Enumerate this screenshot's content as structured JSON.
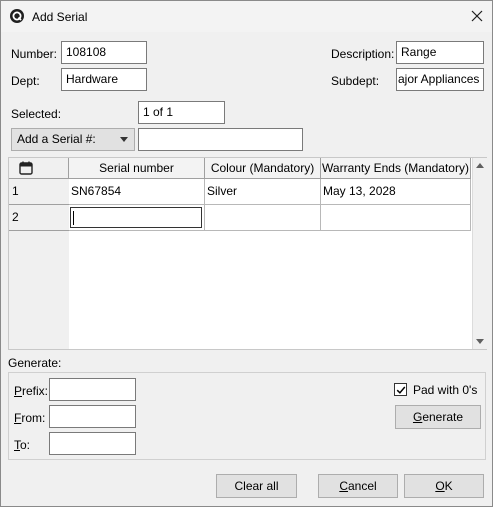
{
  "window": {
    "title": "Add Serial",
    "app_icon": "app-logo-icon",
    "close_icon": "close-icon"
  },
  "form": {
    "number_label": "Number:",
    "number_value": "108108",
    "description_label": "Description:",
    "description_value": "Range",
    "dept_label": "Dept:",
    "dept_value": "Hardware",
    "subdept_label": "Subdept:",
    "subdept_value": "ajor Appliances",
    "selected_label": "Selected:",
    "selected_value": "1 of 1",
    "add_serial_label": "Add a Serial #:",
    "add_serial_value": ""
  },
  "grid": {
    "columns": [
      "Serial number",
      "Colour (Mandatory)",
      "Warranty Ends (Mandatory)"
    ],
    "rows": [
      {
        "num": "1",
        "serial": "SN67854",
        "colour": "Silver",
        "warranty": "May 13, 2028"
      },
      {
        "num": "2",
        "serial": "",
        "colour": "",
        "warranty": ""
      }
    ],
    "corner_icon": "calendar-icon"
  },
  "generate": {
    "section_label": "Generate:",
    "prefix_first": "P",
    "prefix_rest": "refix:",
    "from_first": "F",
    "from_rest": "rom:",
    "to_first": "T",
    "to_rest": "o:",
    "prefix_value": "",
    "from_value": "",
    "to_value": "",
    "pad_label": "Pad with 0's",
    "pad_checked": true,
    "generate_first": "G",
    "generate_rest": "enerate"
  },
  "footer": {
    "clear_all": "Clear all",
    "cancel_first": "C",
    "cancel_rest": "ancel",
    "ok_first": "O",
    "ok_rest": "K"
  }
}
